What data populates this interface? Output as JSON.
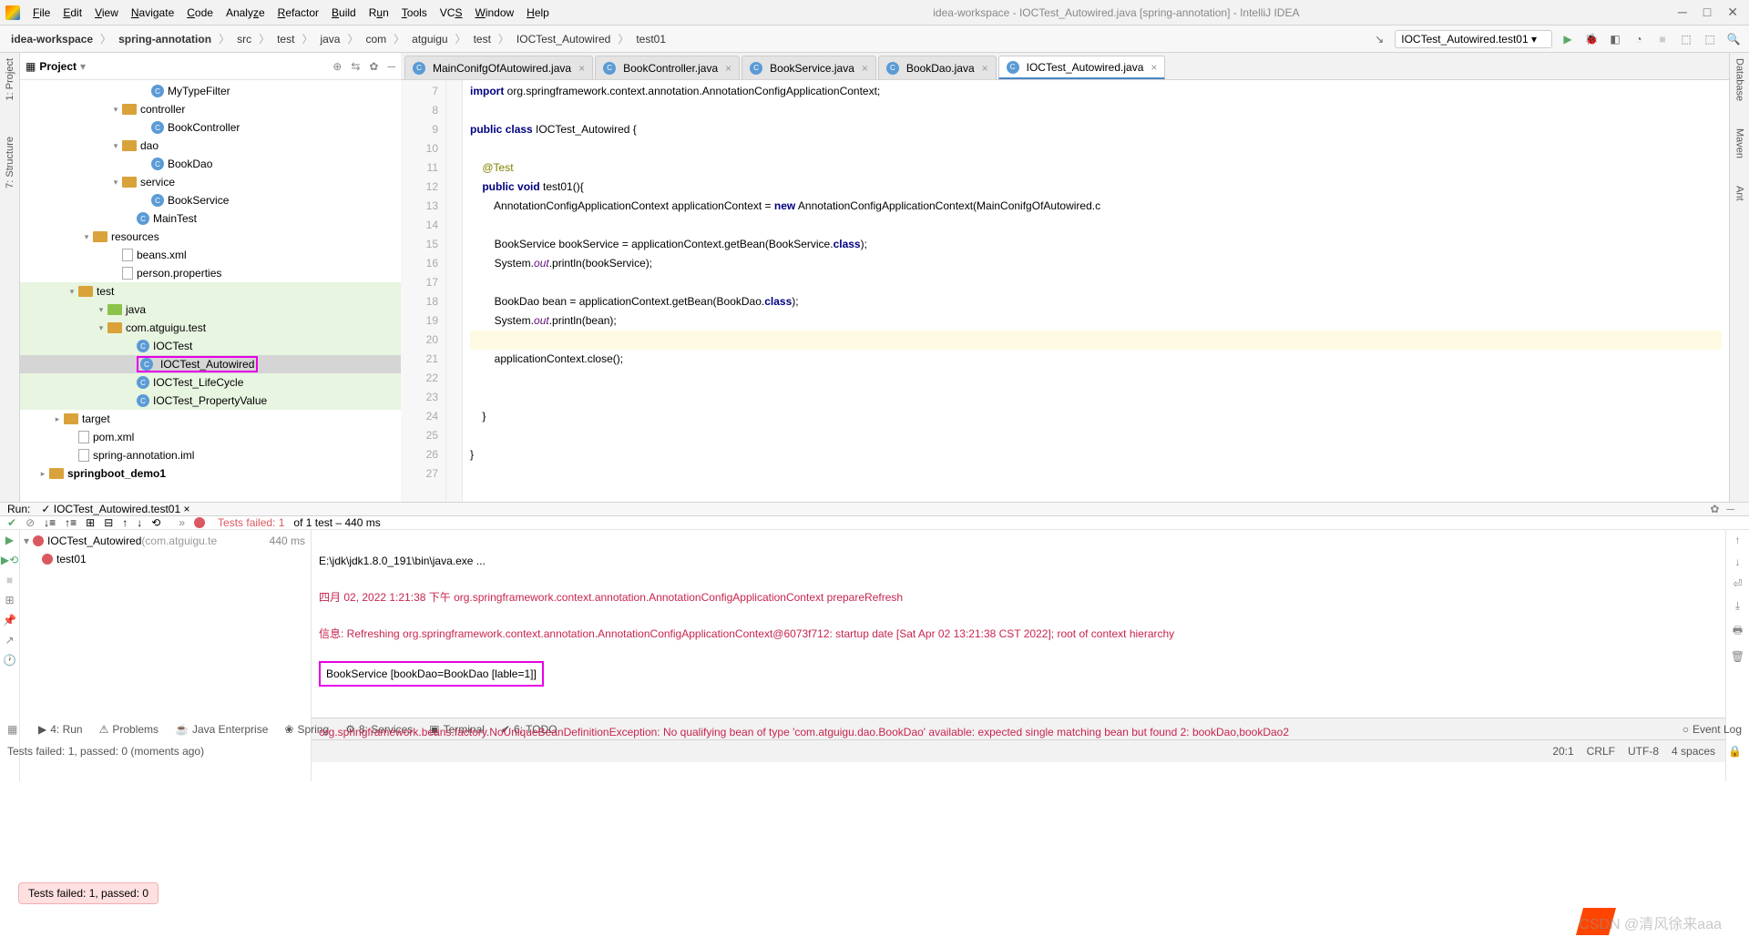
{
  "window": {
    "title": "idea-workspace - IOCTest_Autowired.java [spring-annotation] - IntelliJ IDEA"
  },
  "menu": [
    "File",
    "Edit",
    "View",
    "Navigate",
    "Code",
    "Analyze",
    "Refactor",
    "Build",
    "Run",
    "Tools",
    "VCS",
    "Window",
    "Help"
  ],
  "breadcrumb": [
    "idea-workspace",
    "spring-annotation",
    "src",
    "test",
    "java",
    "com",
    "atguigu",
    "test",
    "IOCTest_Autowired",
    "test01"
  ],
  "run_config": "IOCTest_Autowired.test01",
  "project_pane": {
    "title": "Project"
  },
  "tree": [
    {
      "indent": 130,
      "icon": "class",
      "label": "MyTypeFilter"
    },
    {
      "indent": 98,
      "arrow": "▾",
      "icon": "folder",
      "label": "controller"
    },
    {
      "indent": 130,
      "icon": "class",
      "label": "BookController"
    },
    {
      "indent": 98,
      "arrow": "▾",
      "icon": "folder",
      "label": "dao"
    },
    {
      "indent": 130,
      "icon": "class",
      "label": "BookDao"
    },
    {
      "indent": 98,
      "arrow": "▾",
      "icon": "folder",
      "label": "service"
    },
    {
      "indent": 130,
      "icon": "class",
      "label": "BookService"
    },
    {
      "indent": 114,
      "icon": "class",
      "label": "MainTest"
    },
    {
      "indent": 66,
      "arrow": "▾",
      "icon": "folder",
      "label": "resources"
    },
    {
      "indent": 98,
      "icon": "file",
      "label": "beans.xml"
    },
    {
      "indent": 98,
      "icon": "file",
      "label": "person.properties"
    },
    {
      "indent": 50,
      "arrow": "▾",
      "icon": "folder",
      "label": "test",
      "green": true
    },
    {
      "indent": 82,
      "arrow": "▾",
      "icon": "folder-green",
      "label": "java",
      "green": true
    },
    {
      "indent": 82,
      "arrow": "▾",
      "icon": "folder",
      "label": "com.atguigu.test",
      "green": true
    },
    {
      "indent": 114,
      "icon": "class",
      "label": "IOCTest",
      "green": true
    },
    {
      "indent": 114,
      "icon": "class",
      "label": "IOCTest_Autowired",
      "sel": true,
      "highlight": true
    },
    {
      "indent": 114,
      "icon": "class",
      "label": "IOCTest_LifeCycle",
      "green": true
    },
    {
      "indent": 114,
      "icon": "class",
      "label": "IOCTest_PropertyValue",
      "green": true
    },
    {
      "indent": 34,
      "arrow": "▸",
      "icon": "folder",
      "label": "target"
    },
    {
      "indent": 50,
      "icon": "file",
      "label": "pom.xml"
    },
    {
      "indent": 50,
      "icon": "file",
      "label": "spring-annotation.iml"
    },
    {
      "indent": 18,
      "arrow": "▸",
      "icon": "folder",
      "label": "springboot_demo1",
      "bold": true
    }
  ],
  "tabs": [
    {
      "label": "MainConifgOfAutowired.java",
      "icon": "class"
    },
    {
      "label": "BookController.java",
      "icon": "class"
    },
    {
      "label": "BookService.java",
      "icon": "class"
    },
    {
      "label": "BookDao.java",
      "icon": "class"
    },
    {
      "label": "IOCTest_Autowired.java",
      "icon": "class",
      "active": true
    }
  ],
  "editor": {
    "start": 7,
    "lines": [
      "import org.springframework.context.annotation.AnnotationConfigApplicationContext;",
      "",
      "public class IOCTest_Autowired {",
      "",
      "    @Test",
      "    public void test01(){",
      "        AnnotationConfigApplicationContext applicationContext = new AnnotationConfigApplicationContext(MainConifgOfAutowired.c",
      "",
      "        BookService bookService = applicationContext.getBean(BookService.class);",
      "        System.out.println(bookService);",
      "",
      "        BookDao bean = applicationContext.getBean(BookDao.class);",
      "        System.out.println(bean);",
      "",
      "        applicationContext.close();",
      "",
      "",
      "    }",
      "",
      "}",
      ""
    ]
  },
  "run": {
    "label": "Run:",
    "config": "IOCTest_Autowired.test01",
    "status": "Tests failed: 1",
    "status_tail": " of 1 test – 440 ms"
  },
  "test_tree": [
    {
      "label": "IOCTest_Autowired",
      "suffix": "(com.atguigu.te",
      "dur": "440 ms",
      "fail": true
    },
    {
      "label": "test01",
      "fail": true,
      "indent": 20
    }
  ],
  "console": {
    "l1": "E:\\jdk\\jdk1.8.0_191\\bin\\java.exe ...",
    "l2": "四月 02, 2022 1:21:38 下午 org.springframework.context.annotation.AnnotationConfigApplicationContext prepareRefresh",
    "l3": "信息: Refreshing org.springframework.context.annotation.AnnotationConfigApplicationContext@6073f712: startup date [Sat Apr 02 13:21:38 CST 2022]; root of context hierarchy",
    "l4": "BookService [bookDao=BookDao [lable=1]]",
    "l5": "org.springframework.beans.factory.NoUniqueBeanDefinitionException: No qualifying bean of type 'com.atguigu.dao.BookDao' available: expected single matching bean but found 2: bookDao,bookDao2"
  },
  "fail_badge": "Tests failed: 1, passed: 0",
  "bottom_tabs": [
    "4: Run",
    "Problems",
    "Java Enterprise",
    "Spring",
    "8: Services",
    "Terminal",
    "6: TODO"
  ],
  "event_log": "Event Log",
  "status": {
    "left": "Tests failed: 1, passed: 0 (moments ago)",
    "pos": "20:1",
    "enc": "CRLF",
    "charset": "UTF-8",
    "lang": "4 spaces"
  },
  "watermark": "CSDN @清风徐来aaa"
}
